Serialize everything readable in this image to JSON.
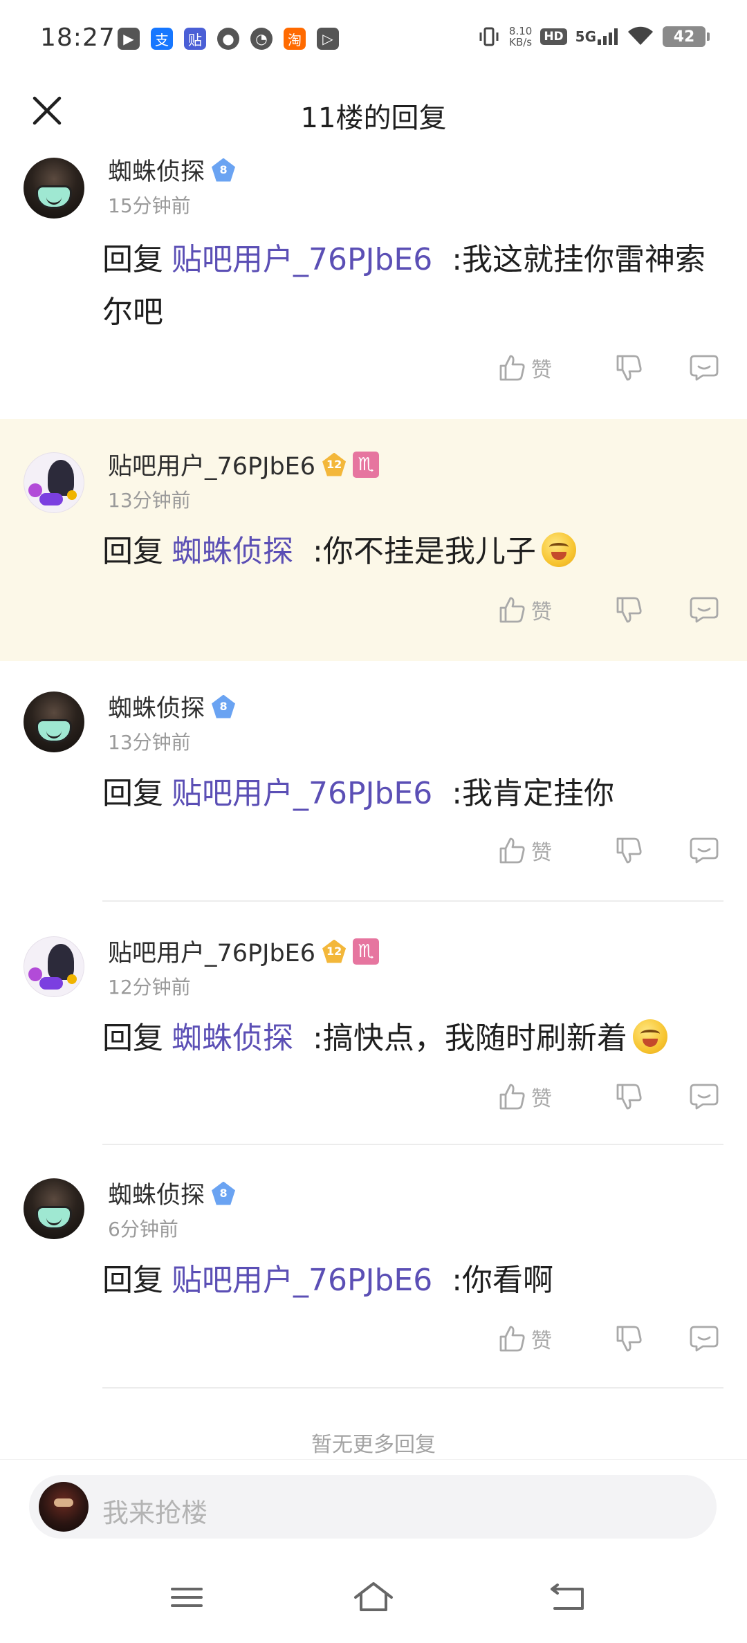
{
  "status_bar": {
    "time": "18:27",
    "apps": [
      {
        "icon": "app-icon-1",
        "color": "#555555",
        "glyph": "▶"
      },
      {
        "icon": "alipay-icon",
        "color": "#1677ff",
        "glyph": "支"
      },
      {
        "icon": "tieba-icon",
        "color": "#4a5fd6",
        "glyph": "贴"
      },
      {
        "icon": "message-icon",
        "color": "#555555",
        "glyph": "●"
      },
      {
        "icon": "compass-icon",
        "color": "#555555",
        "glyph": "◔"
      },
      {
        "icon": "taobao-icon",
        "color": "#ff6a00",
        "glyph": "淘"
      },
      {
        "icon": "video-icon",
        "color": "#555555",
        "glyph": "▷"
      }
    ],
    "net_speed_value": "8.10",
    "net_speed_unit": "KB/s",
    "hd": "HD",
    "network": "5G",
    "battery": "42"
  },
  "header": {
    "title": "11楼的回复"
  },
  "replies": [
    {
      "username": "蜘蛛侦探",
      "level": "8",
      "time": "15分钟前",
      "prefix": "回复",
      "target": "贴吧用户_76PJbE6",
      "content": ":我这就挂你雷神索尔吧",
      "like_label": "赞"
    },
    {
      "username": "贴吧用户_76PJbE6",
      "level": "12",
      "zodiac": "♏",
      "time": "13分钟前",
      "prefix": "回复",
      "target": "蜘蛛侦探",
      "content": ":你不挂是我儿子",
      "like_label": "赞"
    },
    {
      "username": "蜘蛛侦探",
      "level": "8",
      "time": "13分钟前",
      "prefix": "回复",
      "target": "贴吧用户_76PJbE6",
      "content": ":我肯定挂你",
      "like_label": "赞"
    },
    {
      "username": "贴吧用户_76PJbE6",
      "level": "12",
      "zodiac": "♏",
      "time": "12分钟前",
      "prefix": "回复",
      "target": "蜘蛛侦探",
      "content": ":搞快点，我随时刷新着",
      "like_label": "赞"
    },
    {
      "username": "蜘蛛侦探",
      "level": "8",
      "time": "6分钟前",
      "prefix": "回复",
      "target": "贴吧用户_76PJbE6",
      "content": ":你看啊",
      "like_label": "赞"
    }
  ],
  "footer": {
    "no_more": "暂无更多回复",
    "input_placeholder": "我来抢楼"
  },
  "colors": {
    "link": "#5b4fb5",
    "highlight_bg": "#fcf8e8",
    "muted": "#9a9a9a"
  }
}
